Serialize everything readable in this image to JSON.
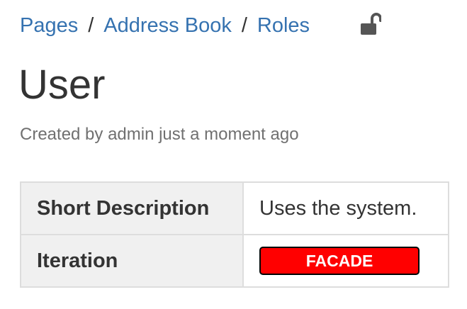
{
  "breadcrumb": {
    "items": [
      {
        "label": "Pages"
      },
      {
        "label": "Address Book"
      },
      {
        "label": "Roles"
      }
    ],
    "separator": "/"
  },
  "lock_icon": {
    "name": "unlocked-padlock-icon",
    "color": "#555555"
  },
  "page": {
    "title": "User",
    "meta": "Created by admin just a moment ago"
  },
  "properties": {
    "rows": [
      {
        "label": "Short Description",
        "value": "Uses the system."
      },
      {
        "label": "Iteration",
        "value": "FACADE"
      }
    ],
    "iteration_badge_color": "#ff0000"
  },
  "colors": {
    "link": "#3572b0",
    "text": "#333333",
    "muted": "#707070"
  }
}
